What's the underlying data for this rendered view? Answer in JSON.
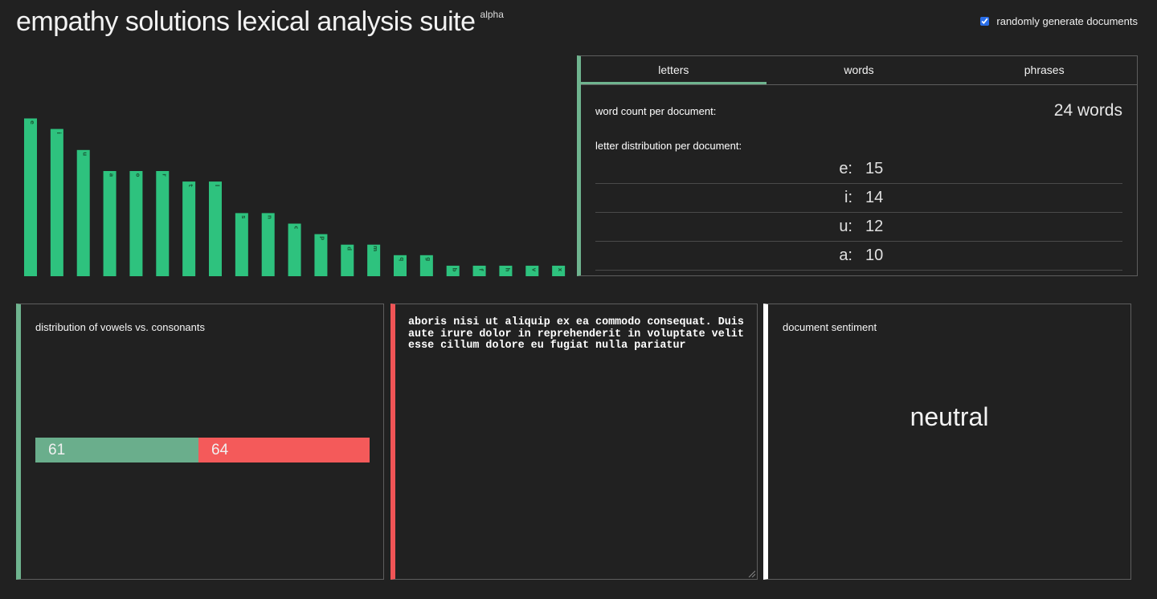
{
  "header": {
    "title": "empathy solutions lexical analysis suite",
    "badge": "alpha",
    "toggle_label": "randomly generate documents",
    "toggle_checked": true,
    "accent_color": "#2a6ee8"
  },
  "chart_data": {
    "type": "bar",
    "categories": [
      "e",
      "i",
      "u",
      "a",
      "o",
      "r",
      "t",
      "l",
      "s",
      "n",
      "c",
      "p",
      "d",
      "m",
      "q",
      "g",
      "b",
      "f",
      "h",
      "v",
      "x"
    ],
    "values": [
      15,
      14,
      12,
      10,
      10,
      10,
      9,
      9,
      6,
      6,
      5,
      4,
      3,
      3,
      2,
      2,
      1,
      1,
      1,
      1,
      1
    ],
    "bar_color": "#2ec27e",
    "title": "",
    "xlabel": "",
    "ylabel": ""
  },
  "letters_panel": {
    "tabs": [
      {
        "label": "letters",
        "active": true
      },
      {
        "label": "words",
        "active": false
      },
      {
        "label": "phrases",
        "active": false
      }
    ],
    "word_count_label": "word count per document:",
    "word_count_value": "24 words",
    "distribution_label": "letter distribution per document:",
    "distribution": [
      {
        "letter": "e:",
        "count": "15"
      },
      {
        "letter": "i:",
        "count": "14"
      },
      {
        "letter": "u:",
        "count": "12"
      },
      {
        "letter": "a:",
        "count": "10"
      }
    ],
    "accent_color": "#6fb48f"
  },
  "vowels_panel": {
    "title": "distribution of vowels vs. consonants",
    "vowels": 61,
    "consonants": 64,
    "vowels_label": "61",
    "consonants_label": "64",
    "vowel_color": "#6aae8c",
    "consonant_color": "#f45a5a"
  },
  "document": {
    "text": "aboris nisi ut aliquip ex ea commodo consequat. Duis aute irure dolor in reprehenderit in voluptate velit esse cillum dolore eu fugiat nulla pariatur",
    "accent_color": "#f05456"
  },
  "sentiment_panel": {
    "title": "document sentiment",
    "value": "neutral"
  }
}
